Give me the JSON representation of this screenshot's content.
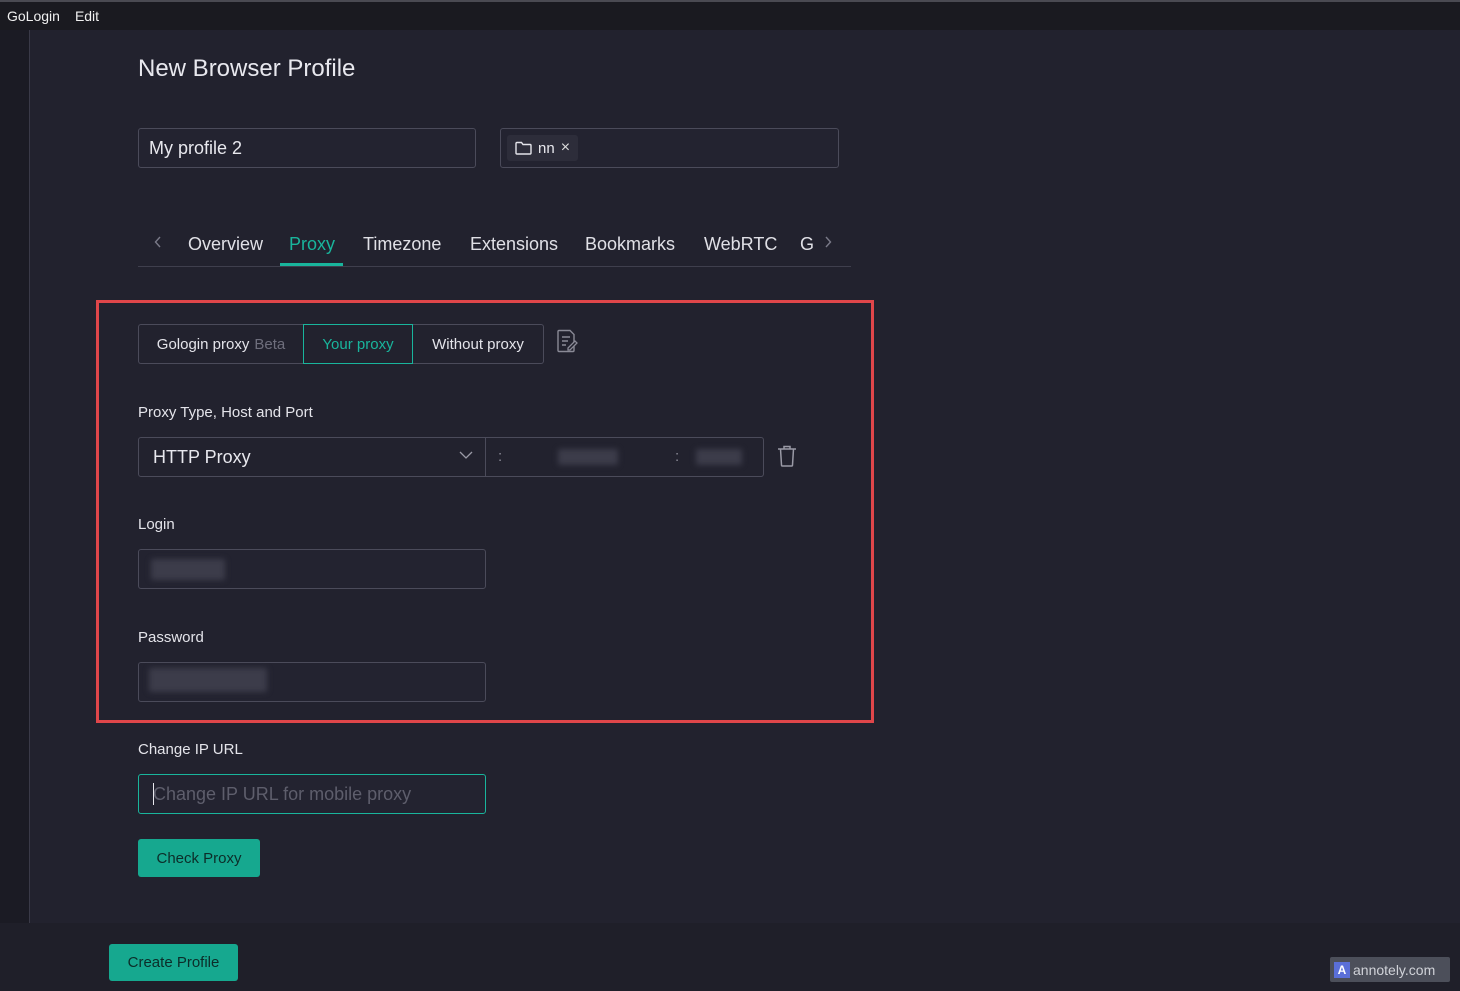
{
  "menubar": {
    "items": [
      "GoLogin",
      "Edit"
    ]
  },
  "page": {
    "title": "New Browser Profile"
  },
  "profile": {
    "name": "My profile 2",
    "folder_tag": "nn",
    "folder_tag_close": "×"
  },
  "tabs": {
    "items": [
      "Overview",
      "Proxy",
      "Timezone",
      "Extensions",
      "Bookmarks",
      "WebRTC",
      "G"
    ],
    "active": "Proxy"
  },
  "proxy_mode": {
    "gologin_label": "Gologin proxy",
    "gologin_badge": "Beta",
    "your_label": "Your proxy",
    "without_label": "Without proxy",
    "selected": "Your proxy"
  },
  "proxy_settings": {
    "type_host_port_label": "Proxy Type, Host and Port",
    "type_value": "HTTP Proxy",
    "host_separator": ":",
    "port_separator": ":",
    "login_label": "Login",
    "password_label": "Password",
    "change_ip_label": "Change IP URL",
    "change_ip_placeholder": "Change IP URL for mobile proxy"
  },
  "buttons": {
    "check_proxy": "Check Proxy",
    "create_profile": "Create Profile"
  },
  "watermark": {
    "logo": "A",
    "text": "annotely.com"
  },
  "colors": {
    "accent": "#19b59c",
    "highlight": "#e0464a",
    "background": "#22222e"
  },
  "icons": [
    "folder-icon",
    "chevron-left-icon",
    "chevron-right-icon",
    "notes-icon",
    "chevron-down-icon",
    "trash-icon"
  ]
}
